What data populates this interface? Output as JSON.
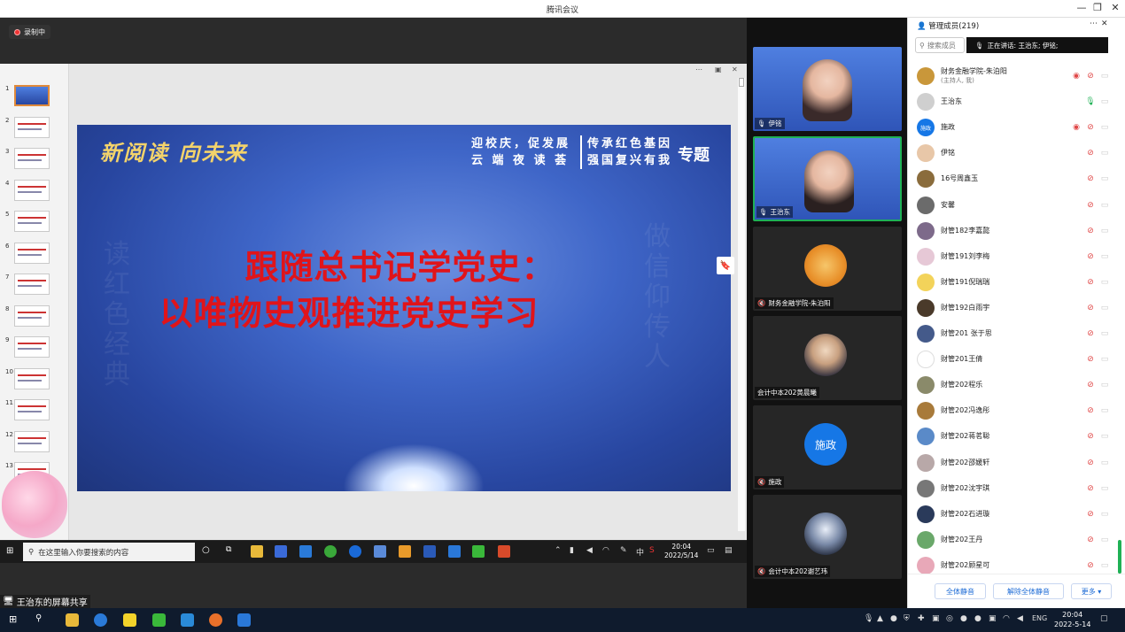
{
  "window": {
    "title": "腾讯会议",
    "minimize": "—",
    "restore": "❐",
    "close": "✕"
  },
  "recording": {
    "label": "录制中"
  },
  "ppt": {
    "slide_numbers": [
      "1",
      "2",
      "3",
      "4",
      "5",
      "6",
      "7",
      "8",
      "9",
      "10",
      "11",
      "12",
      "13",
      "14"
    ],
    "slide": {
      "header_left": "新阅读 向未来",
      "header_mid_1": "迎校庆，促发展",
      "header_mid_2": "云 端 夜 读 荟",
      "header_right_1": "传承红色基因",
      "header_right_2": "强国复兴有我",
      "header_tag": "专题",
      "title_line1": "跟随总书记学党史：",
      "title_line2": "以唯物史观推进党史学习",
      "watermark_left": "读红色经典",
      "watermark_right": "做信仰传人"
    }
  },
  "remote_taskbar": {
    "search_placeholder": "在这里输入你要搜索的内容",
    "time": "20:04",
    "date": "2022/5/14",
    "ime": "中"
  },
  "share_label": "王治东的屏幕共享",
  "videos": [
    {
      "name": "伊铭",
      "type": "slide-camera"
    },
    {
      "name": "王治东",
      "type": "slide-camera",
      "active": true
    },
    {
      "name": "财务金融学院-朱泊阳",
      "type": "avatar"
    },
    {
      "name": "会计中本202黄晨曦",
      "type": "avatar"
    },
    {
      "name": "施政",
      "type": "initials",
      "initials": "施政"
    },
    {
      "name": "会计中本202谢艺玮",
      "type": "avatar"
    }
  ],
  "panel": {
    "title": "管理成员(219)",
    "search_placeholder": "搜索成员",
    "speaking": "正在讲话: 王治东; 伊铭;",
    "members": [
      {
        "name": "财务金融学院-朱泊阳",
        "sub": "(主持人, 我)",
        "color": "#c9973a",
        "rec": true
      },
      {
        "name": "王治东",
        "sub": "",
        "color": "#cfcfcf",
        "mic_on": true
      },
      {
        "name": "施政",
        "sub": "",
        "color": "#1677e6",
        "initials": "施政",
        "rec": true
      },
      {
        "name": "伊铭",
        "sub": "",
        "color": "#e8c7a8"
      },
      {
        "name": "16号周鑫玉",
        "sub": "",
        "color": "#8a6c3c"
      },
      {
        "name": "安馨",
        "sub": "",
        "color": "#6b6b6b"
      },
      {
        "name": "财管182李嘉懿",
        "sub": "",
        "color": "#7d6a8a"
      },
      {
        "name": "财管191刘李梅",
        "sub": "",
        "color": "#e6c8d6"
      },
      {
        "name": "财管191倪瑞瑞",
        "sub": "",
        "color": "#f3d35a"
      },
      {
        "name": "财管192白雨宇",
        "sub": "",
        "color": "#4a3a2a"
      },
      {
        "name": "财管201 张于思",
        "sub": "",
        "color": "#445a8a"
      },
      {
        "name": "财管201王倩",
        "sub": "",
        "color": "#ffffff"
      },
      {
        "name": "财管202程乐",
        "sub": "",
        "color": "#8a8a6a"
      },
      {
        "name": "财管202冯逸彤",
        "sub": "",
        "color": "#a87a3a"
      },
      {
        "name": "财管202蒋茗聪",
        "sub": "",
        "color": "#5a8ac8"
      },
      {
        "name": "财管202邵媛轩",
        "sub": "",
        "color": "#b8a8a8"
      },
      {
        "name": "财管202沈宇琪",
        "sub": "",
        "color": "#777777"
      },
      {
        "name": "财管202石进璇",
        "sub": "",
        "color": "#2a3a5a"
      },
      {
        "name": "财管202王丹",
        "sub": "",
        "color": "#6aa86a"
      },
      {
        "name": "财管202顾星可",
        "sub": "",
        "color": "#e8a8b8"
      }
    ],
    "footer": {
      "mute_all": "全体静音",
      "unmute_all": "解除全体静音",
      "more": "更多 ▾"
    }
  },
  "local_taskbar": {
    "lang": "ENG",
    "time": "20:04",
    "date": "2022-5-14"
  },
  "colors": {
    "accent": "#1677e6",
    "active_speaker": "#1fb155",
    "muted": "#e04848",
    "slide_title": "#e0141a"
  }
}
